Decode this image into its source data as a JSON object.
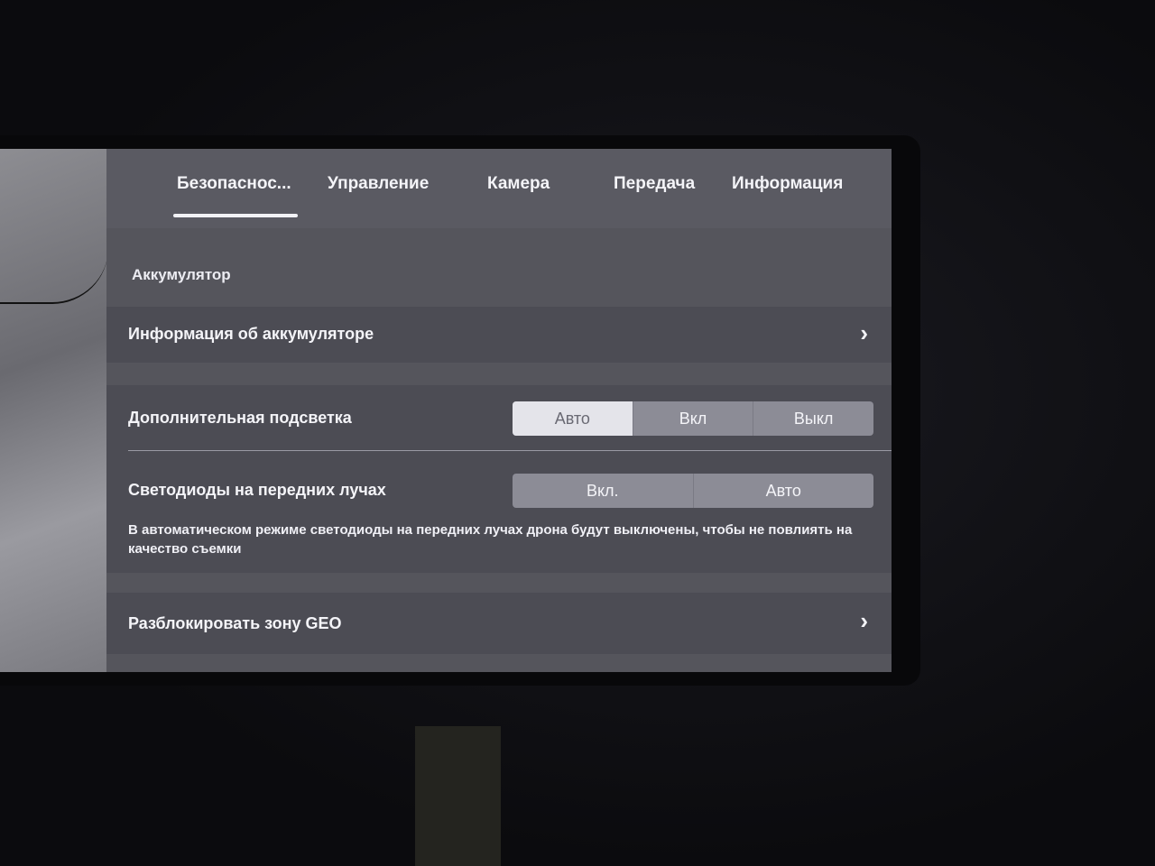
{
  "tabs": [
    {
      "label": "Безопаснос...",
      "active": true
    },
    {
      "label": "Управление",
      "active": false
    },
    {
      "label": "Камера",
      "active": false
    },
    {
      "label": "Передача",
      "active": false
    },
    {
      "label": "Информация",
      "active": false
    }
  ],
  "battery": {
    "section_label": "Аккумулятор",
    "info_label": "Информация об аккумуляторе"
  },
  "aux_light": {
    "label": "Дополнительная подсветка",
    "options": [
      "Авто",
      "Вкл",
      "Выкл"
    ],
    "selected": "Авто"
  },
  "front_leds": {
    "label": "Светодиоды на передних лучах",
    "options": [
      "Вкл.",
      "Авто"
    ],
    "description": "В автоматическом режиме светодиоды на передних лучах дрона будут выключены, чтобы не повлиять на качество съемки"
  },
  "geo": {
    "label": "Разблокировать зону GEO"
  },
  "icons": {
    "chevron": "chevron-right-icon"
  },
  "colors": {
    "panel": "#55555c",
    "active_segment": "#e4e4ea"
  }
}
